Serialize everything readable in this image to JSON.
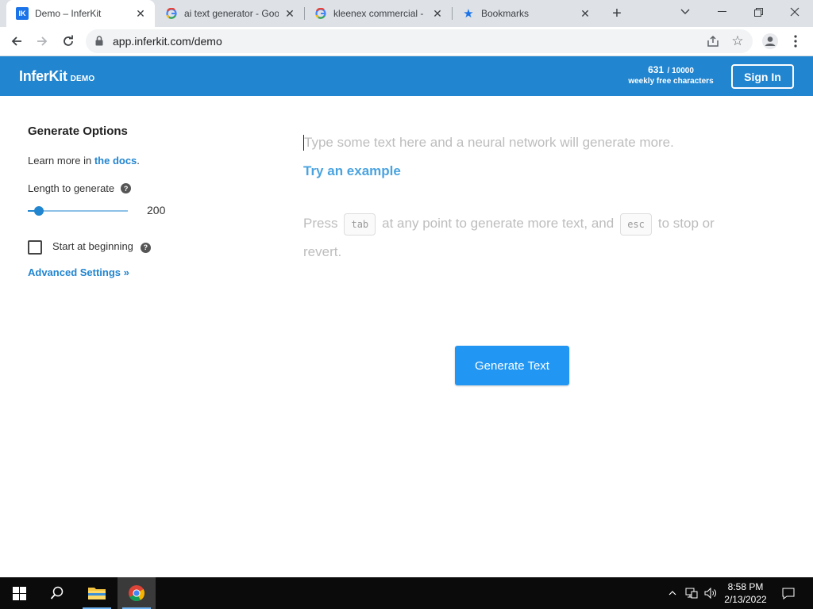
{
  "browser": {
    "tabs": [
      {
        "title": "Demo – InferKit",
        "favicon": "inferkit-ik-icon",
        "active": true
      },
      {
        "title": "ai text generator - Goo",
        "favicon": "google-g-icon",
        "active": false
      },
      {
        "title": "kleenex commercial - G",
        "favicon": "google-g-icon",
        "active": false
      },
      {
        "title": "Bookmarks",
        "favicon": "star-icon",
        "active": false
      }
    ],
    "url": "app.inferkit.com/demo"
  },
  "header": {
    "logo": "InferKit",
    "logo_badge": "DEMO",
    "char_count": "631",
    "char_limit": "/ 10000",
    "char_label": "weekly free characters",
    "signin_label": "Sign In",
    "brand_color": "#2185d0"
  },
  "options": {
    "title": "Generate Options",
    "learn_prefix": "Learn more in ",
    "docs_link": "the docs",
    "learn_suffix": ".",
    "length_label": "Length to generate",
    "length_value": "200",
    "length_fraction": 0.11,
    "start_label": "Start at beginning",
    "start_checked": false,
    "advanced_label": "Advanced Settings »"
  },
  "editor": {
    "placeholder": "Type some text here and a neural network will generate more.",
    "try_example": "Try an example",
    "press_prefix": "Press",
    "key_tab": "tab",
    "press_middle": "at any point to generate more text, and",
    "key_esc": "esc",
    "press_suffix": "to stop or revert.",
    "generate_label": "Generate Text",
    "button_color": "#2196f3"
  },
  "taskbar": {
    "time": "8:58 PM",
    "date": "2/13/2022"
  }
}
